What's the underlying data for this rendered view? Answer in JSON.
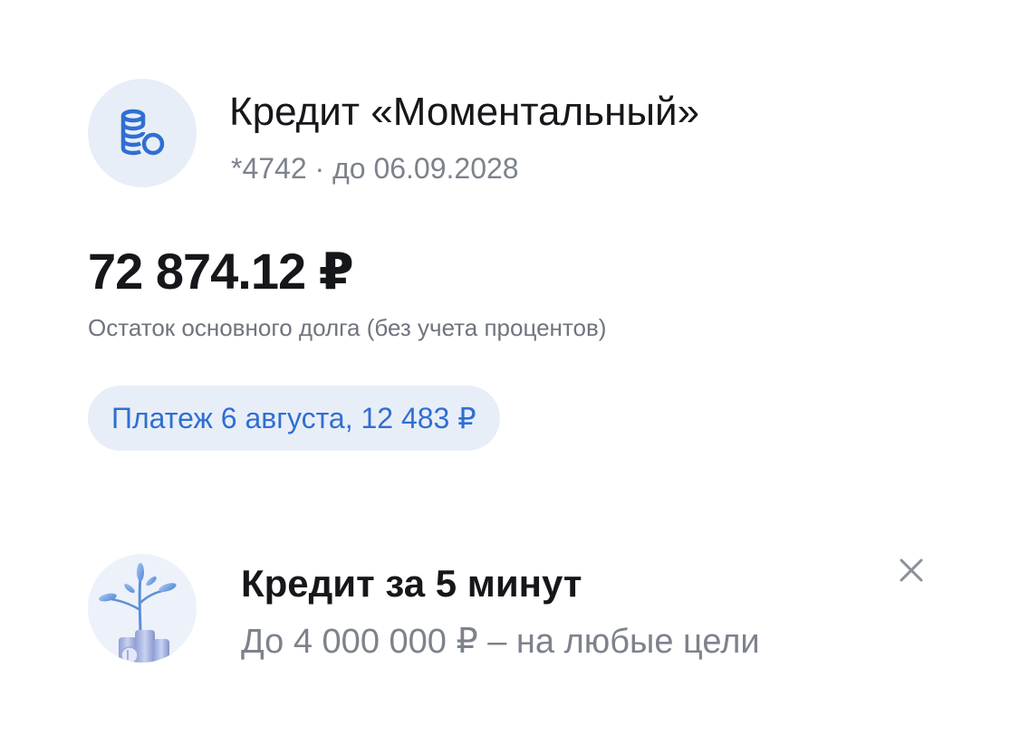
{
  "loan": {
    "icon": "coins-stack-icon",
    "title": "Кредит «Моментальный»",
    "subtitle": "*4742 · до 06.09.2028",
    "amount": "72 874.12 ₽",
    "amount_caption": "Остаток основного долга (без учета процентов)",
    "payment_label": "Платеж 6 августа, 12 483 ₽"
  },
  "promo": {
    "icon": "money-plant-icon",
    "title": "Кредит за 5 минут",
    "subtitle": "До 4 000 000 ₽ –  на любые цели",
    "close_icon": "close-icon"
  },
  "colors": {
    "accent": "#2f6fd2",
    "chip_background": "#e8eef8",
    "primary_text": "#16171a",
    "secondary_text": "#7d828c"
  }
}
